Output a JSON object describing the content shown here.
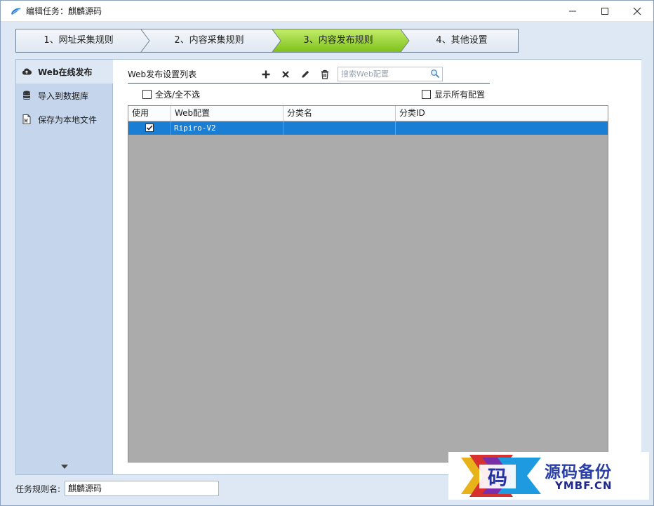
{
  "window": {
    "title": "编辑任务：麒麟源码"
  },
  "steps": [
    {
      "label": "1、网址采集规则",
      "active": false
    },
    {
      "label": "2、内容采集规则",
      "active": false
    },
    {
      "label": "3、内容发布规则",
      "active": true
    },
    {
      "label": "4、其他设置",
      "active": false
    }
  ],
  "sidebar": {
    "items": [
      {
        "label": "Web在线发布",
        "icon": "cloud-upload-icon",
        "active": true
      },
      {
        "label": "导入到数据库",
        "icon": "database-icon",
        "active": false
      },
      {
        "label": "保存为本地文件",
        "icon": "file-word-icon",
        "active": false
      }
    ]
  },
  "publish": {
    "section_title": "Web发布设置列表",
    "search_placeholder": "搜索Web配置",
    "select_all_label": "全选/全不选",
    "show_all_label": "显示所有配置"
  },
  "grid": {
    "columns": [
      "使用",
      "Web配置",
      "分类名",
      "分类ID"
    ],
    "rows": [
      {
        "use": true,
        "web_config": "Ripiro-V2",
        "category_name": "",
        "category_id": ""
      }
    ]
  },
  "footer": {
    "label": "任务规则名:",
    "value": "麒麟源码"
  },
  "watermark": {
    "glyph": "码",
    "text_cn": "源码备份",
    "text_en": "YMBF.CN"
  },
  "colors": {
    "active_step": "#9ad43a",
    "selection": "#1a7fd4",
    "grid_bg": "#ababab",
    "sidebar_bg": "#c5d6ec"
  }
}
